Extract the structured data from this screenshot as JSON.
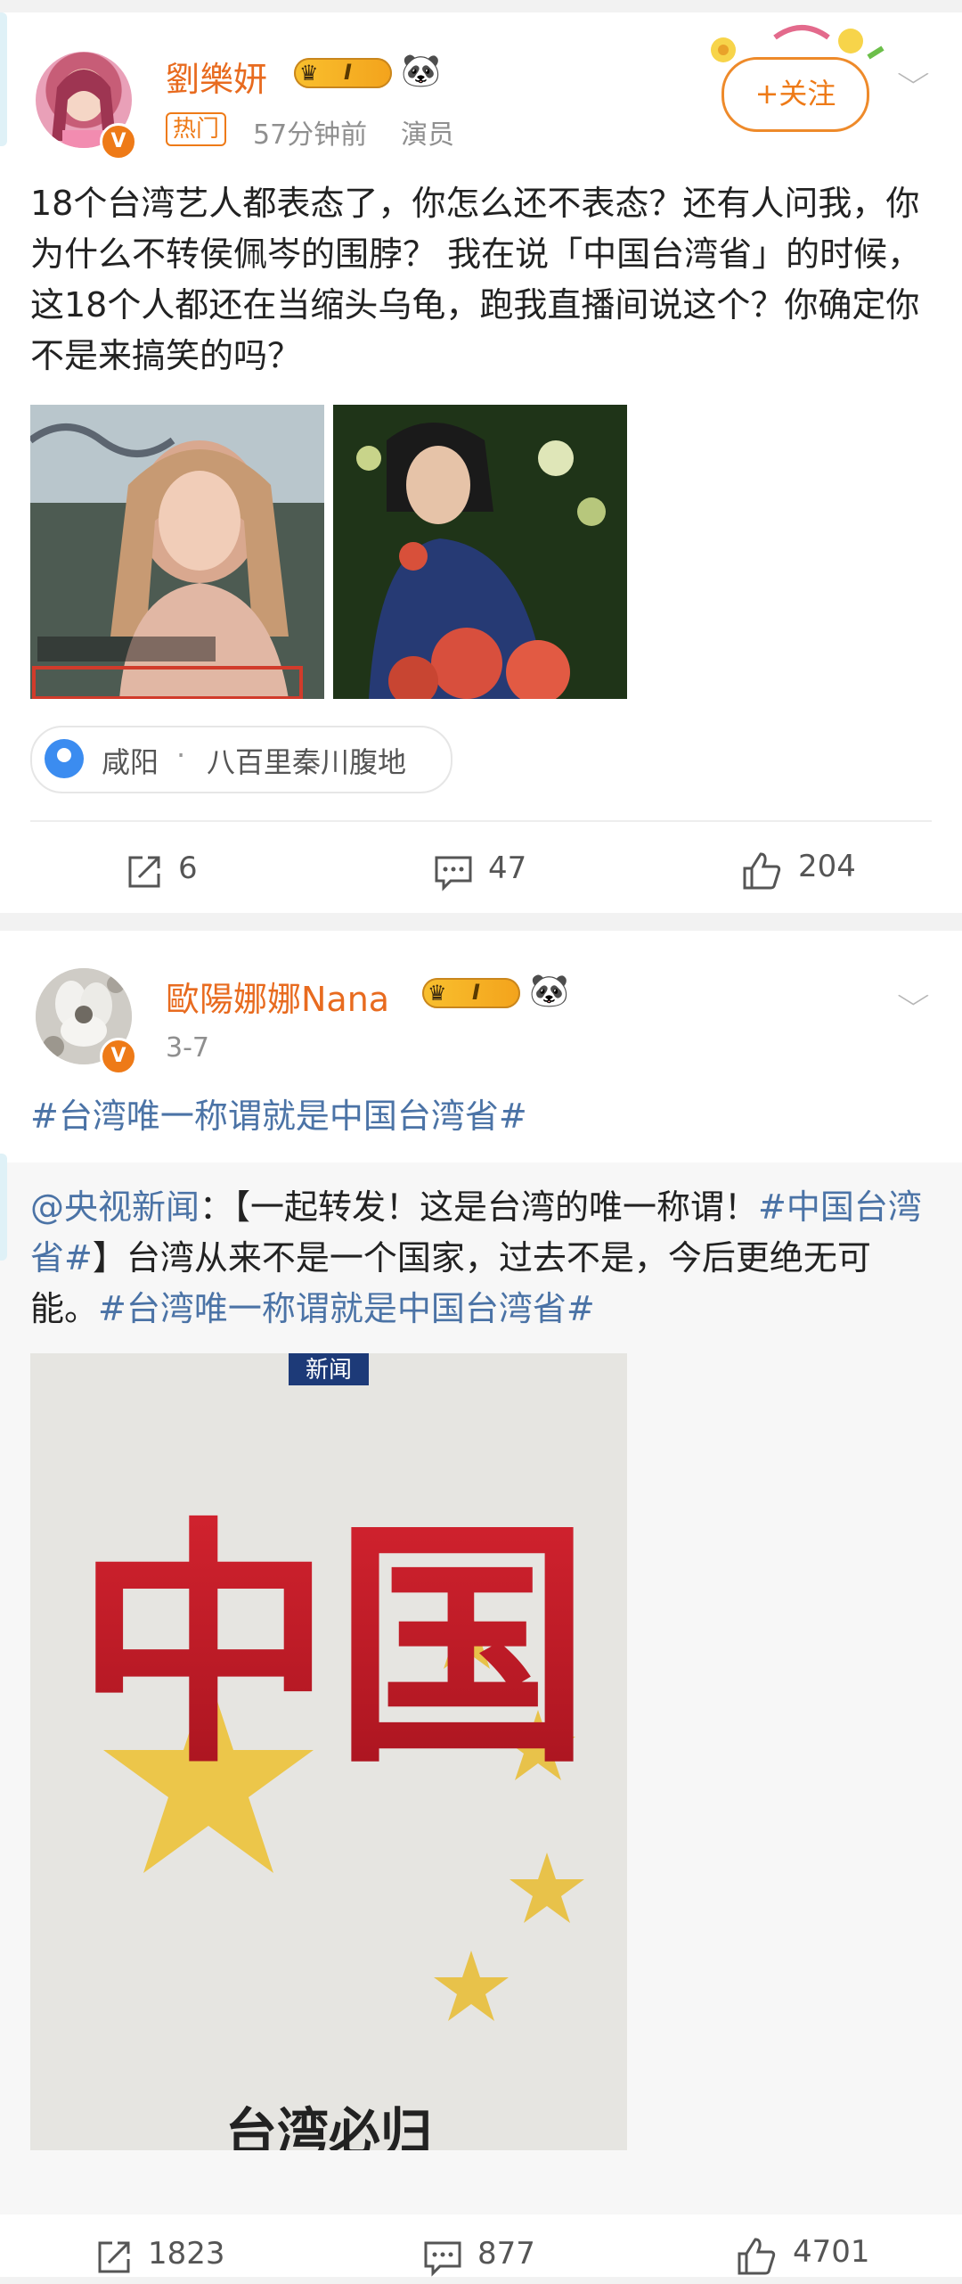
{
  "post1": {
    "username": "劉樂妍",
    "badge_level": "I",
    "hot_tag": "热门",
    "time": "57分钟前",
    "role": "演员",
    "follow_label": "+关注",
    "text": "18个台湾艺人都表态了，你怎么还不表态？还有人问我，你为什么不转侯佩岑的围脖？ 我在说「中国台湾省」的时候，这18个人都还在当缩头乌龟，跑我直播间说这个？你确定你不是来搞笑的吗？",
    "location_city": "咸阳",
    "location_sep": "·",
    "location_place": "八百里秦川腹地",
    "shares": "6",
    "comments": "47",
    "likes": "204"
  },
  "post2": {
    "username": "歐陽娜娜Nana",
    "badge_level": "I",
    "time": "3-7",
    "hashtag": "#台湾唯一称谓就是中国台湾省#",
    "repost": {
      "mention": "@央视新闻",
      "colon": "：",
      "text_a": "【一起转发！这是台湾的唯一称谓！",
      "link_a": "#中国台湾省#",
      "text_b": "】台湾从来不是一个国家，过去不是，今后更绝无可能。",
      "link_b": "#台湾唯一称谓就是中国台湾省#"
    },
    "image_tag": "新闻",
    "image_headline": "中国",
    "image_footer": "台湾必归",
    "shares": "1823",
    "comments": "877",
    "likes": "4701"
  },
  "colors": {
    "accent_orange": "#ee7a17",
    "link_blue": "#4b73a6",
    "username_orange": "#e86b1f"
  },
  "icons": [
    "share-icon",
    "comment-icon",
    "like-icon",
    "location-pin-icon",
    "chevron-down-icon",
    "crown-icon",
    "panda-icon",
    "verified-icon"
  ]
}
